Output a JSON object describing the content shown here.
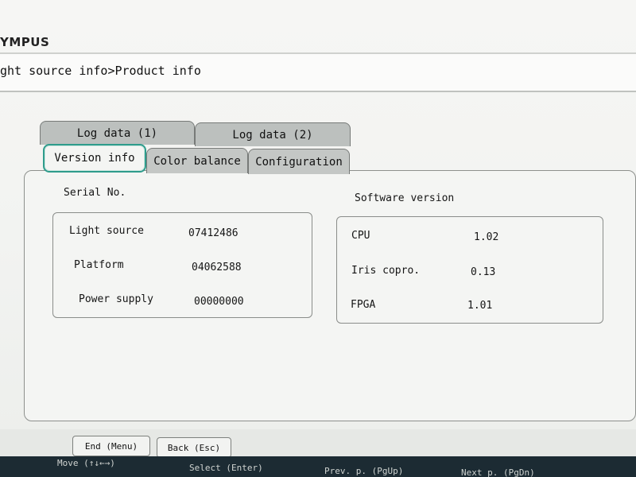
{
  "brand": "YMPUS",
  "breadcrumb": "ght source info>Product info",
  "tabs_back": [
    {
      "label": "Log data (1)"
    },
    {
      "label": "Log data (2)"
    }
  ],
  "tabs_front": [
    {
      "label": "Version info",
      "active": true
    },
    {
      "label": "Color balance",
      "active": false
    },
    {
      "label": "Configuration",
      "active": false
    }
  ],
  "serial": {
    "title": "Serial No.",
    "rows": [
      {
        "label": "Light source",
        "value": "07412486"
      },
      {
        "label": "Platform",
        "value": "04062588"
      },
      {
        "label": "Power supply",
        "value": "00000000"
      }
    ]
  },
  "software": {
    "title": "Software version",
    "rows": [
      {
        "label": "CPU",
        "value": "1.02"
      },
      {
        "label": "Iris copro.",
        "value": "0.13"
      },
      {
        "label": "FPGA",
        "value": "1.01"
      }
    ]
  },
  "footer_buttons": {
    "end": "End (Menu)",
    "back": "Back (Esc)"
  },
  "key_hints": {
    "move": "Move (↑↓←→)",
    "select": "Select (Enter)",
    "prev": "Prev. p. (PgUp)",
    "next": "Next p. (PgDn)"
  },
  "colors": {
    "active_tab_border": "#2f9c8c",
    "panel_background": "#f4f5f3",
    "hint_bar": "#1c2b33"
  }
}
